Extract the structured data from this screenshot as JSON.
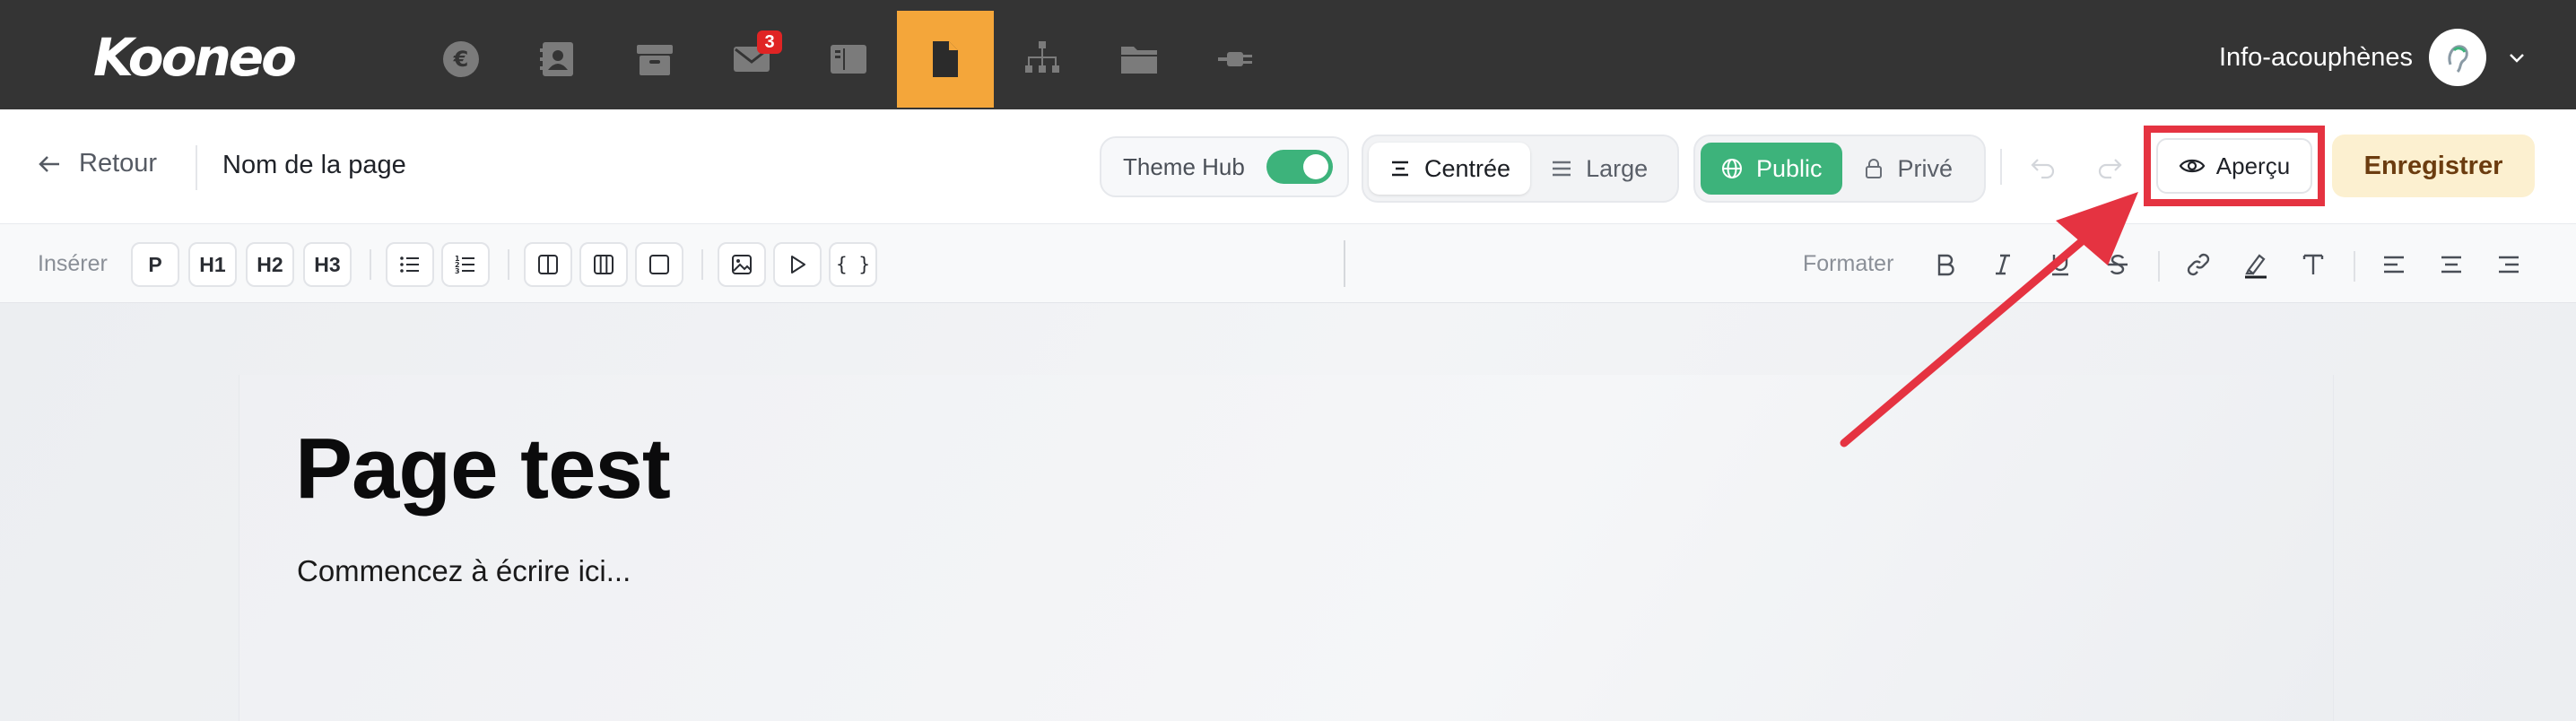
{
  "topbar": {
    "logo": "Kooneo",
    "nav": [
      {
        "icon": "euro-icon"
      },
      {
        "icon": "contacts-book-icon"
      },
      {
        "icon": "box-icon"
      },
      {
        "icon": "mail-icon",
        "badge": "3"
      },
      {
        "icon": "layout-icon"
      },
      {
        "icon": "page-icon",
        "active": true
      },
      {
        "icon": "sitemap-icon"
      },
      {
        "icon": "folder-icon"
      },
      {
        "icon": "plug-icon"
      }
    ],
    "account_name": "Info-acouphènes"
  },
  "header": {
    "back_label": "Retour",
    "page_name": "Nom de la page",
    "theme_hub_label": "Theme Hub",
    "theme_hub_on": true,
    "layout_options": {
      "centered": "Centrée",
      "wide": "Large",
      "selected": "Centrée"
    },
    "visibility_options": {
      "public": "Public",
      "private": "Privé",
      "selected": "Public"
    },
    "preview_label": "Aperçu",
    "save_label": "Enregistrer"
  },
  "toolbar": {
    "insert_label": "Insérer",
    "insert_buttons": [
      "P",
      "H1",
      "H2",
      "H3"
    ],
    "code_button": "{ }",
    "format_label": "Formater"
  },
  "canvas": {
    "title": "Page test",
    "body": "Commencez à écrire ici..."
  },
  "colors": {
    "topbar": "#343434",
    "active_nav": "#f4a63a",
    "green": "#3db37b",
    "save_bg": "#fcf0d0",
    "annotation_red": "#e53341"
  }
}
